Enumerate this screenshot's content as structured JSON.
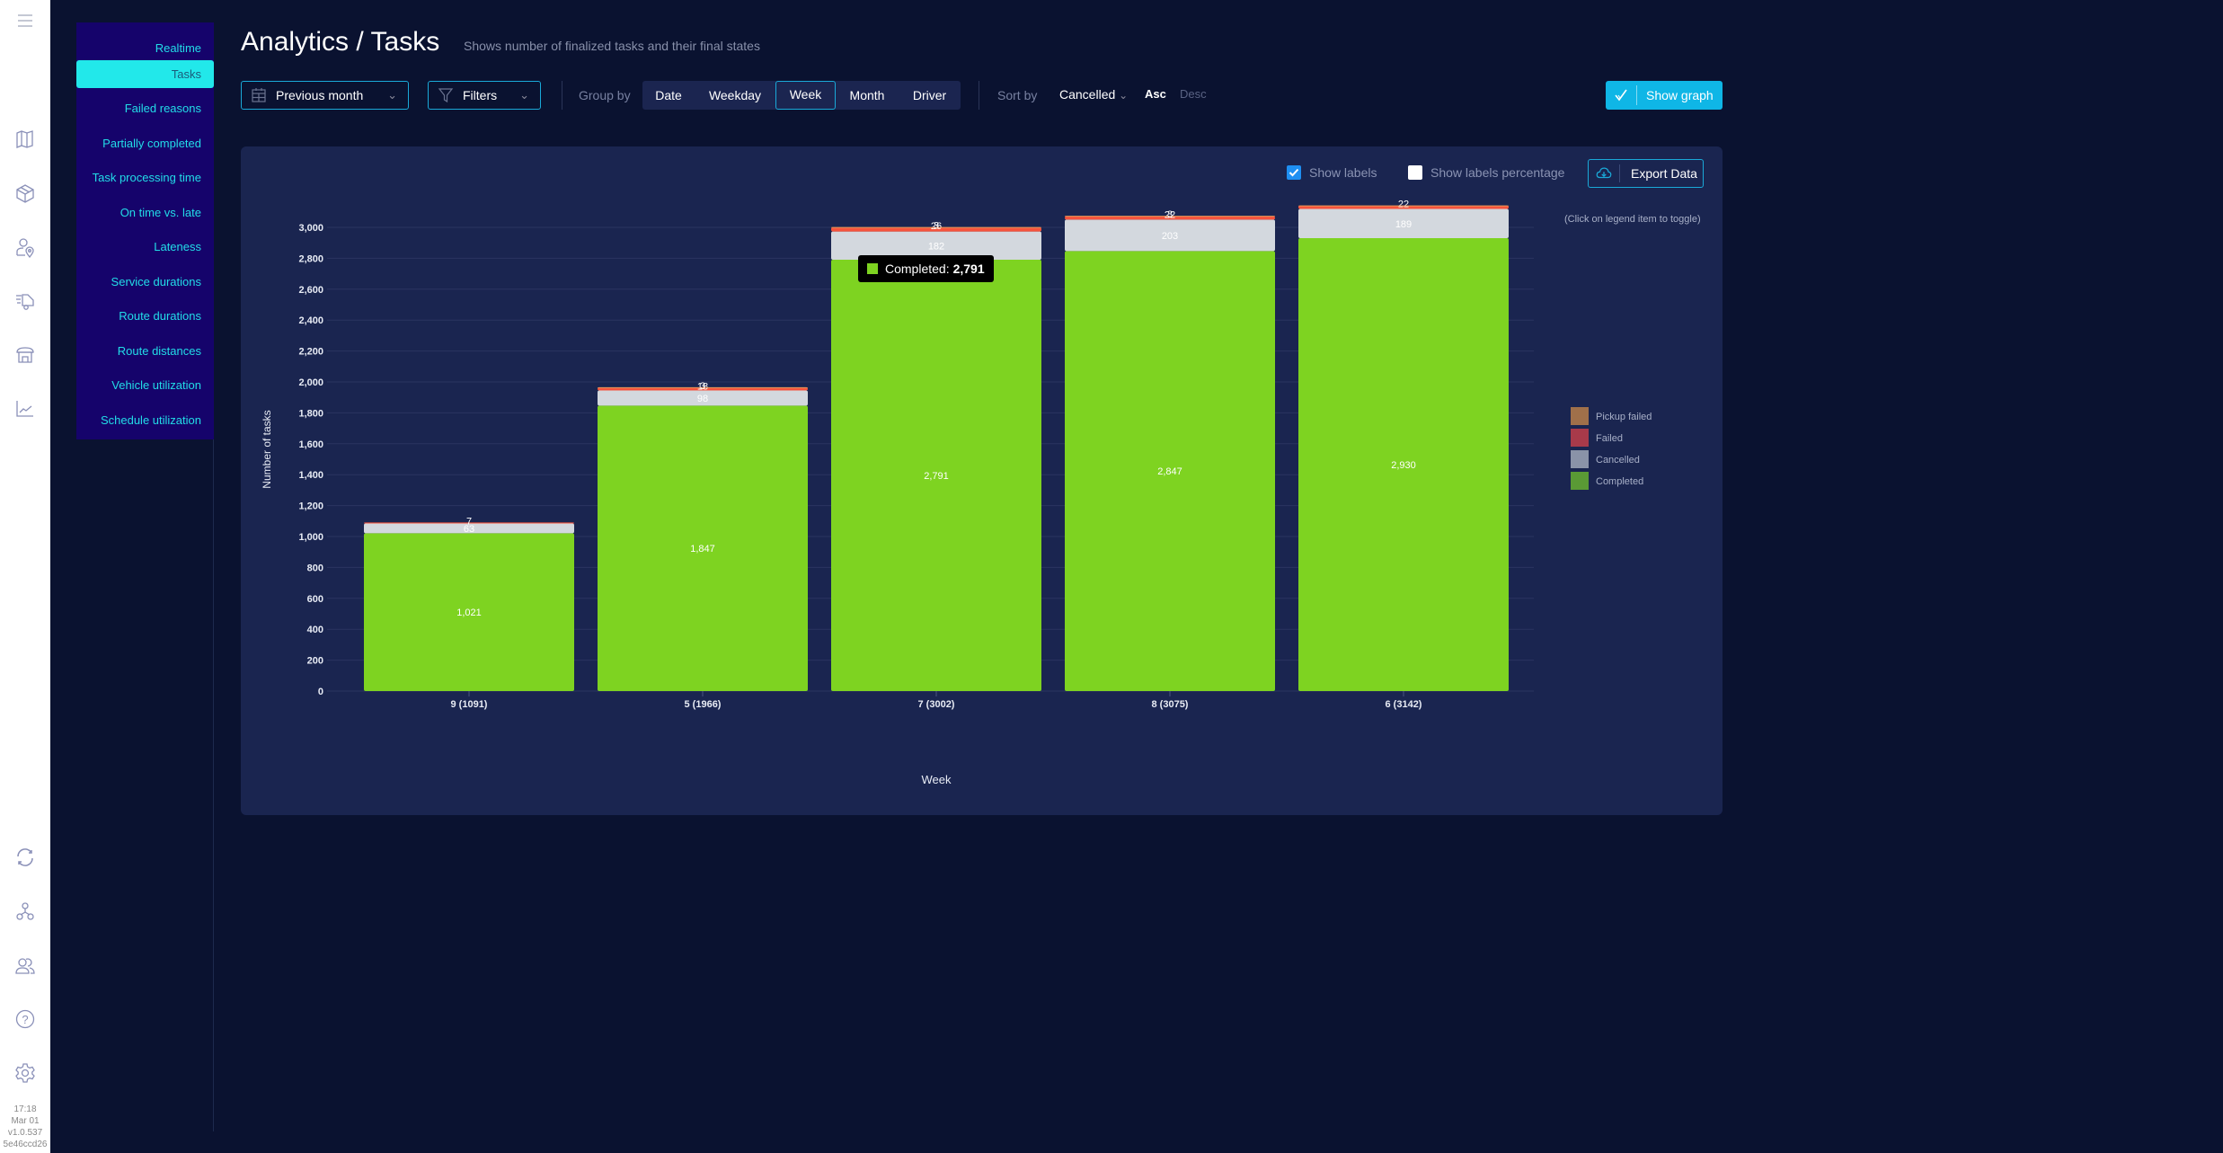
{
  "left_icons": [
    "menu-icon",
    "map-icon",
    "box-icon",
    "user-location-icon",
    "delivery-truck-icon",
    "store-icon",
    "analytics-chart-icon"
  ],
  "left_icons_bottom": [
    "sync-icon",
    "network-icon",
    "users-icon",
    "help-icon",
    "settings-icon"
  ],
  "meta": {
    "time": "17:18",
    "date": "Mar 01",
    "version": "v1.0.537",
    "hash": "5e46ccd26"
  },
  "submenu": {
    "items": [
      {
        "label": "Realtime",
        "active": false
      },
      {
        "label": "Tasks",
        "active": true
      },
      {
        "label": "Failed reasons",
        "active": false
      },
      {
        "label": "Partially completed",
        "active": false
      },
      {
        "label": "Task processing time",
        "active": false
      },
      {
        "label": "On time vs. late",
        "active": false
      },
      {
        "label": "Lateness",
        "active": false
      },
      {
        "label": "Service durations",
        "active": false
      },
      {
        "label": "Route durations",
        "active": false
      },
      {
        "label": "Route distances",
        "active": false
      },
      {
        "label": "Vehicle utilization",
        "active": false
      },
      {
        "label": "Schedule utilization",
        "active": false
      }
    ]
  },
  "header": {
    "title": "Analytics / Tasks",
    "subtitle": "Shows number of finalized tasks and their final states"
  },
  "toolbar": {
    "period": "Previous month",
    "filters": "Filters",
    "group_by_label": "Group by",
    "group_by_options": [
      {
        "label": "Date",
        "active": false
      },
      {
        "label": "Weekday",
        "active": false
      },
      {
        "label": "Week",
        "active": true
      },
      {
        "label": "Month",
        "active": false
      },
      {
        "label": "Driver",
        "active": false
      }
    ],
    "sort_by_label": "Sort by",
    "sort_by_value": "Cancelled",
    "asc": "Asc",
    "desc": "Desc",
    "show_graph": "Show graph"
  },
  "panel": {
    "show_labels": "Show labels",
    "show_labels_checked": true,
    "show_labels_percentage": "Show labels percentage",
    "show_labels_percentage_checked": false,
    "export": "Export Data",
    "legend_hint": "(Click on legend item to toggle)"
  },
  "tooltip": {
    "series": "Completed",
    "value": "2,791"
  },
  "chart_data": {
    "type": "bar",
    "stacked": true,
    "title": "",
    "xlabel": "Week",
    "ylabel": "Number of tasks",
    "ylim": [
      0,
      3000
    ],
    "yticks": [
      0,
      200,
      400,
      600,
      800,
      1000,
      1200,
      1400,
      1600,
      1800,
      2000,
      2200,
      2400,
      2600,
      2800,
      3000
    ],
    "ytick_labels": [
      "0",
      "200",
      "400",
      "600",
      "800",
      "1,000",
      "1,200",
      "1,400",
      "1,600",
      "1,800",
      "2,000",
      "2,200",
      "2,400",
      "2,600",
      "2,800",
      "3,000"
    ],
    "categories": [
      "9 (1091)",
      "5 (1966)",
      "7 (3002)",
      "8 (3075)",
      "6 (3142)"
    ],
    "grid": true,
    "legend_position": "right",
    "series": [
      {
        "name": "Completed",
        "color": "#7ed321",
        "legend_color": "#5a9a35",
        "values": [
          1021,
          1847,
          2791,
          2847,
          2930
        ],
        "labels": [
          "1,021",
          "1,847",
          "2,791",
          "2,847",
          "2,930"
        ]
      },
      {
        "name": "Cancelled",
        "color": "#d3d8de",
        "legend_color": "#8a93a8",
        "values": [
          63,
          98,
          182,
          203,
          189
        ],
        "labels": [
          "63",
          "98",
          "182",
          "203",
          "189"
        ]
      },
      {
        "name": "Failed",
        "color": "#f5533d",
        "legend_color": "#a83a4a",
        "values": [
          7,
          18,
          26,
          22,
          22
        ],
        "labels": [
          "7",
          "18",
          "26",
          "22",
          "22"
        ]
      },
      {
        "name": "Pickup failed",
        "color": "#e89a5a",
        "legend_color": "#a0704a",
        "values": [
          0,
          3,
          3,
          3,
          1
        ],
        "labels": [
          "",
          "3",
          "3",
          "3",
          ""
        ]
      }
    ],
    "legend_order": [
      "Pickup failed",
      "Failed",
      "Cancelled",
      "Completed"
    ]
  }
}
